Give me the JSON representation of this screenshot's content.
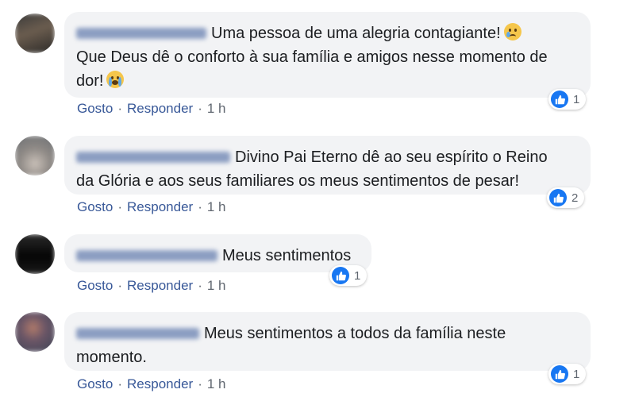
{
  "comments": [
    {
      "author_blurred": true,
      "lines": [
        "Uma pessoa de uma alegria contagiante!",
        "Que Deus dê o conforto à sua família e amigos nesse momento de",
        "dor!"
      ],
      "emoji_1": "sad-tear-face-emoji",
      "emoji_2": "crying-face-emoji",
      "reaction_count": "1",
      "like_label": "Gosto",
      "reply_label": "Responder",
      "time": "1 h"
    },
    {
      "author_blurred": true,
      "lines": [
        "Divino Pai Eterno dê ao seu espírito o Reino",
        "da Glória e aos seus familiares os meus sentimentos de pesar!"
      ],
      "reaction_count": "2",
      "like_label": "Gosto",
      "reply_label": "Responder",
      "time": "1 h"
    },
    {
      "author_blurred": true,
      "lines": [
        "Meus sentimentos"
      ],
      "reaction_count": "1",
      "like_label": "Gosto",
      "reply_label": "Responder",
      "time": "1 h"
    },
    {
      "author_blurred": true,
      "lines": [
        "Meus sentimentos a todos da família neste",
        "momento."
      ],
      "reaction_count": "1",
      "like_label": "Gosto",
      "reply_label": "Responder",
      "time": "1 h"
    }
  ],
  "colors": {
    "link": "#385898",
    "bubble": "#f2f3f5",
    "like_blue": "#1877f2",
    "meta_gray": "#606770"
  },
  "separator": "·"
}
